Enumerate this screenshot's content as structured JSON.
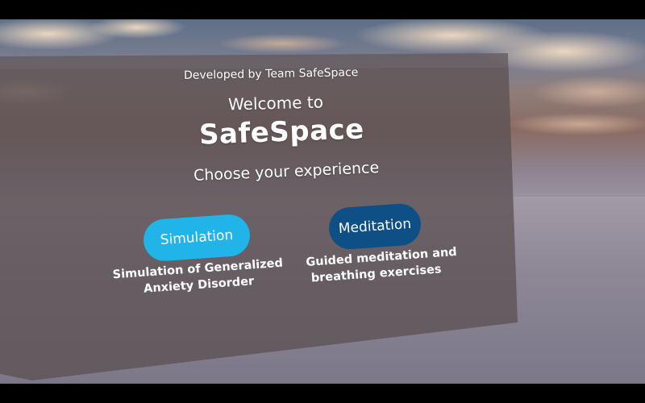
{
  "panel": {
    "credit": "Developed by Team SafeSpace",
    "welcome": "Welcome to",
    "app_name": "SafeSpace",
    "prompt": "Choose your experience"
  },
  "options": [
    {
      "button_label": "Simulation",
      "description_line1": "Simulation of Generalized",
      "description_line2": "Anxiety Disorder",
      "color": "#21b4e8"
    },
    {
      "button_label": "Meditation",
      "description_line1": "Guided meditation and",
      "description_line2": "breathing exercises",
      "color": "#0e4f86"
    }
  ]
}
